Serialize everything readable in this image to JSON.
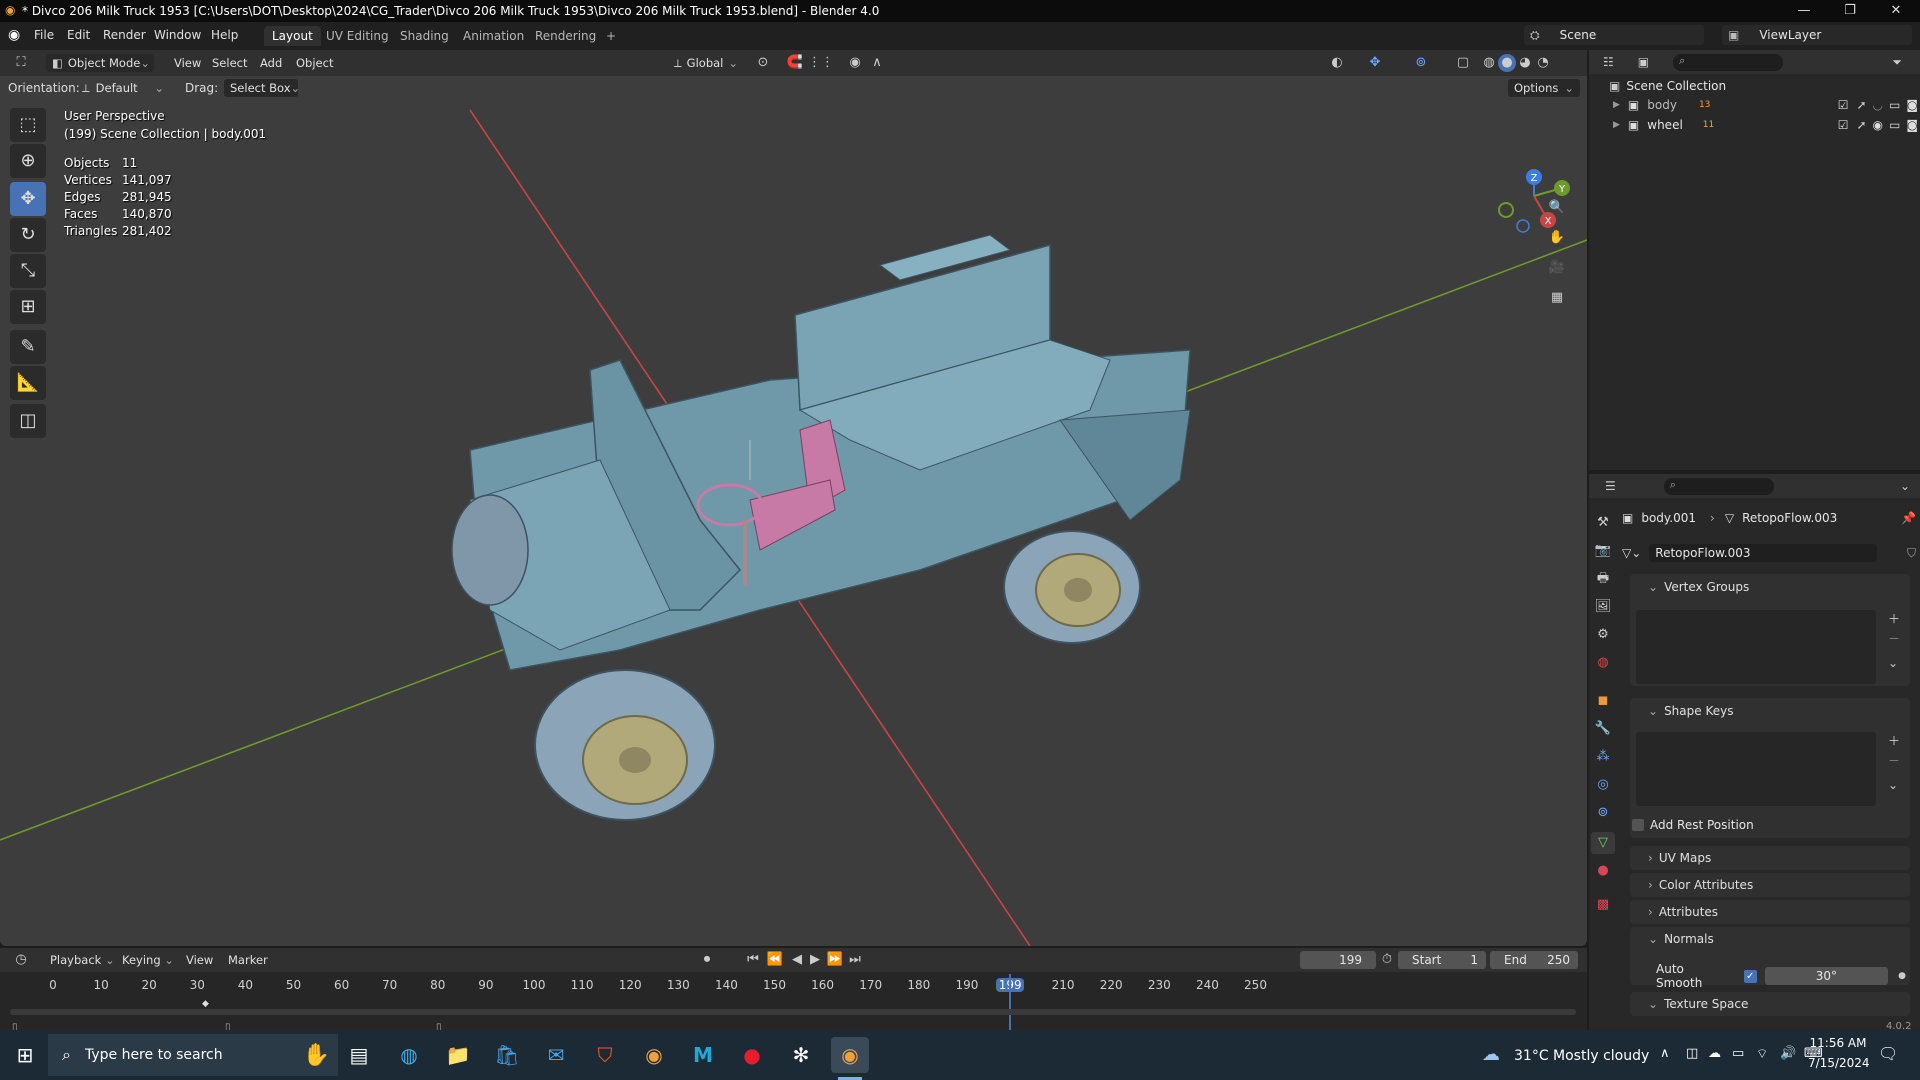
{
  "title_bar": {
    "title": "* Divco 206 Milk Truck 1953 [C:\\Users\\DOT\\Desktop\\2024\\CG_Trader\\Divco 206 Milk Truck 1953\\Divco 206 Milk Truck 1953.blend] - Blender 4.0",
    "minimize": "—",
    "maximize": "❐",
    "close": "✕"
  },
  "menu": {
    "items": [
      "File",
      "Edit",
      "Render",
      "Window",
      "Help"
    ],
    "workspaces": [
      "Layout",
      "UV Editing",
      "Shading",
      "Animation",
      "Rendering"
    ],
    "add_workspace": "+",
    "scene_label": "Scene",
    "view_layer_label": "ViewLayer"
  },
  "viewport_header": {
    "mode": "Object Mode",
    "menus": [
      "View",
      "Select",
      "Add",
      "Object"
    ],
    "transform_orientation": "Global",
    "orientation_label": "Orientation:",
    "orientation_value": "Default",
    "drag_label": "Drag:",
    "drag_value": "Select Box",
    "options": "Options"
  },
  "viewport_overlay": {
    "view_name": "User Perspective",
    "collection_info": "(199) Scene Collection | body.001",
    "stats": [
      {
        "label": "Objects",
        "value": "11"
      },
      {
        "label": "Vertices",
        "value": "141,097"
      },
      {
        "label": "Edges",
        "value": "281,945"
      },
      {
        "label": "Faces",
        "value": "140,870"
      },
      {
        "label": "Triangles",
        "value": "281,402"
      }
    ],
    "gizmo_axes": [
      "Z",
      "Y",
      "X"
    ]
  },
  "outliner": {
    "root": "Scene Collection",
    "collections": [
      {
        "name": "body",
        "count": "13"
      },
      {
        "name": "wheel",
        "count": "11"
      }
    ]
  },
  "properties": {
    "object": "body.001",
    "mesh": "RetopoFlow.003",
    "mesh_field": "RetopoFlow.003",
    "panels": {
      "vertex_groups": "Vertex Groups",
      "shape_keys": "Shape Keys",
      "add_rest_position": "Add Rest Position",
      "uv_maps": "UV Maps",
      "color_attributes": "Color Attributes",
      "attributes": "Attributes",
      "normals": "Normals",
      "auto_smooth": "Auto Smooth",
      "auto_smooth_angle": "30°",
      "texture_space": "Texture Space"
    },
    "version": "4.0.2"
  },
  "timeline": {
    "menus": [
      "Playback",
      "Keying",
      "View",
      "Marker"
    ],
    "current_frame": "199",
    "start_label": "Start",
    "start": "1",
    "end_label": "End",
    "end": "250",
    "ruler": [
      "0",
      "10",
      "20",
      "30",
      "40",
      "50",
      "60",
      "70",
      "80",
      "90",
      "100",
      "110",
      "120",
      "130",
      "140",
      "150",
      "160",
      "170",
      "180",
      "190",
      "199",
      "210",
      "220",
      "230",
      "240",
      "250"
    ],
    "playhead_frame": 199
  },
  "taskbar": {
    "search_placeholder": "Type here to search",
    "weather": "31°C  Mostly cloudy",
    "time": "11:56 AM",
    "date": "7/15/2024"
  },
  "colors": {
    "accent": "#4772b3",
    "viewport_bg": "#3d3d3d",
    "x_axis": "#c84545",
    "y_axis": "#6d9a2c",
    "model": "#6f98a8",
    "seat": "#c77aa6",
    "hubcap": "#b1a97a"
  }
}
